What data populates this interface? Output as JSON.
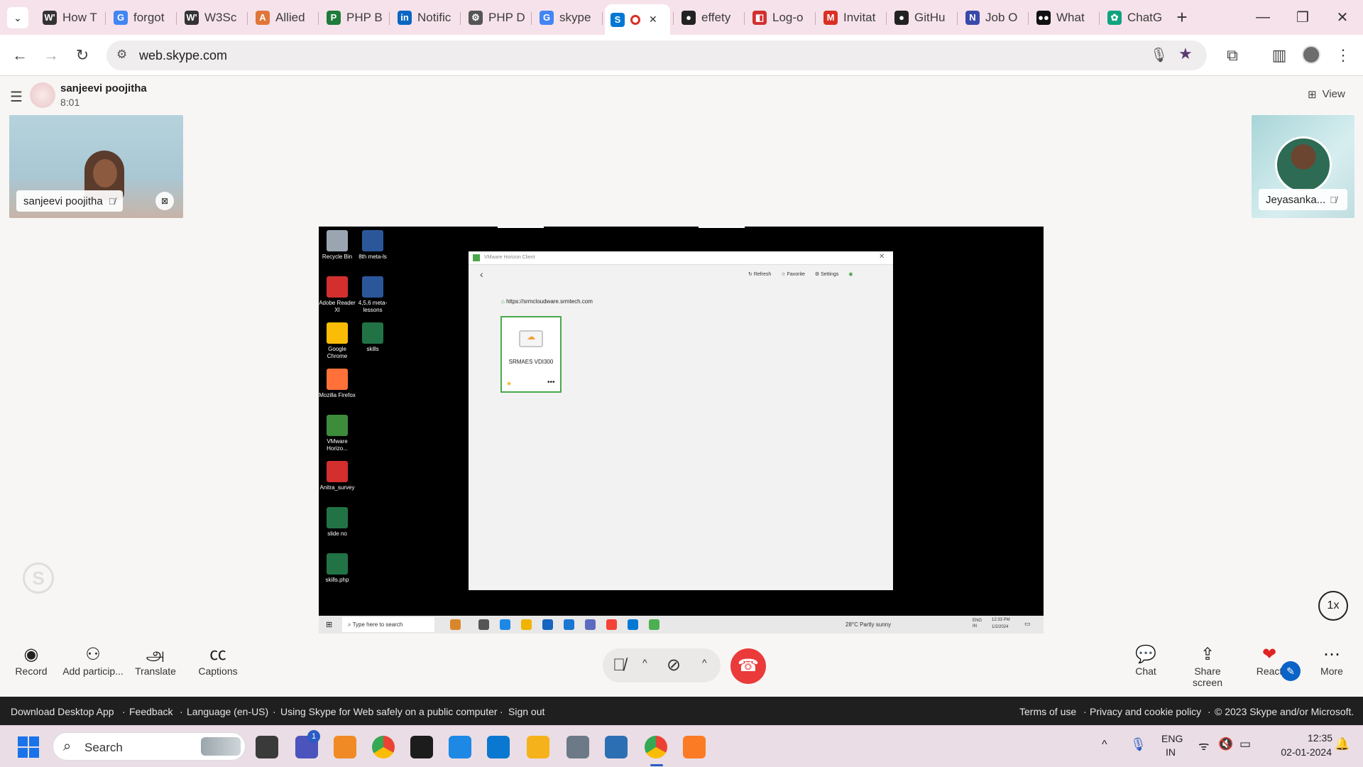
{
  "browser": {
    "tabs": [
      {
        "label": "How T",
        "icon": "wikipedia-icon",
        "fav": "W'",
        "color": "#333"
      },
      {
        "label": "forgot",
        "icon": "google-icon",
        "fav": "G",
        "color": "#4285f4"
      },
      {
        "label": "W3Sc",
        "icon": "wikipedia-icon",
        "fav": "W'",
        "color": "#333"
      },
      {
        "label": "Allied",
        "icon": "allied-icon",
        "fav": "A",
        "color": "#e0763a"
      },
      {
        "label": "PHP B",
        "icon": "php-icon",
        "fav": "P",
        "color": "#1e7b3a"
      },
      {
        "label": "Notific",
        "icon": "linkedin-icon",
        "fav": "in",
        "color": "#0a66c2"
      },
      {
        "label": "PHP D",
        "icon": "gear-icon",
        "fav": "⚙",
        "color": "#555"
      },
      {
        "label": "skype",
        "icon": "google-icon",
        "fav": "G",
        "color": "#4285f4"
      },
      {
        "label": "",
        "icon": "skype-icon",
        "fav": "S",
        "color": "#0078d4"
      },
      {
        "label": "effety",
        "icon": "github-icon",
        "fav": "●",
        "color": "#222"
      },
      {
        "label": "Log-o",
        "icon": "log-icon",
        "fav": "◧",
        "color": "#d32f2f"
      },
      {
        "label": "Invitat",
        "icon": "gmail-icon",
        "fav": "M",
        "color": "#d93025"
      },
      {
        "label": "GitHu",
        "icon": "github-icon",
        "fav": "●",
        "color": "#222"
      },
      {
        "label": "Job O",
        "icon": "naukri-icon",
        "fav": "N",
        "color": "#3949ab"
      },
      {
        "label": "What",
        "icon": "medium-icon",
        "fav": "●●",
        "color": "#111"
      },
      {
        "label": "ChatG",
        "icon": "chatgpt-icon",
        "fav": "✿",
        "color": "#10a37f"
      }
    ],
    "url": "web.skype.com"
  },
  "call": {
    "caller_name": "sanjeevi poojitha",
    "duration": "8:01",
    "view_label": "View",
    "tile_left_name": "sanjeevi poojitha",
    "tile_right_name": "Jeyasanka...",
    "speed": "1x"
  },
  "shared_screen": {
    "desktop_icons": [
      {
        "label": "Recycle Bin",
        "color": "#9aa5b1"
      },
      {
        "label": "8th meta-ls",
        "color": "#2b579a"
      },
      {
        "label": "Adobe Reader XI",
        "color": "#d32f2f"
      },
      {
        "label": "4,5,6 meta-lessons",
        "color": "#2b579a"
      },
      {
        "label": "Google Chrome",
        "color": "#fbbc05"
      },
      {
        "label": "skills",
        "color": "#217346"
      },
      {
        "label": "Mozilla Firefox",
        "color": "#ff7139"
      },
      {
        "label": "VMware Horizo...",
        "color": "#3c8c3c"
      },
      {
        "label": "Anitra_survey",
        "color": "#d32f2f"
      },
      {
        "label": "slide no",
        "color": "#217346"
      },
      {
        "label": "skills.php",
        "color": "#217346"
      }
    ],
    "vmware": {
      "title": "VMware Horizon Client",
      "refresh": "Refresh",
      "favorite": "Favorite",
      "settings": "Settings",
      "server_url": "https://srmcloudware.srmtech.com",
      "desktop_name": "SRMAES VDI300"
    },
    "remote_taskbar": {
      "search": "Type here to search",
      "weather": "28°C  Partly sunny",
      "lang": "ENG IN",
      "time": "12:33 PM",
      "date": "1/2/2024"
    }
  },
  "controls": {
    "record": "Record",
    "add": "Add particip...",
    "translate": "Translate",
    "captions": "Captions",
    "chat": "Chat",
    "share": "Share screen",
    "react": "React",
    "more": "More"
  },
  "footer": {
    "download": "Download Desktop App",
    "feedback": "Feedback",
    "language": "Language (en-US)",
    "safety": "Using Skype for Web safely on a public computer",
    "signout": "Sign out",
    "terms": "Terms of use",
    "privacy": "Privacy and cookie policy",
    "copyright": "© 2023 Skype and/or Microsoft."
  },
  "taskbar": {
    "search": "Search",
    "teams_badge": "1",
    "lang_top": "ENG",
    "lang_bottom": "IN",
    "time": "12:35",
    "date": "02-01-2024"
  }
}
